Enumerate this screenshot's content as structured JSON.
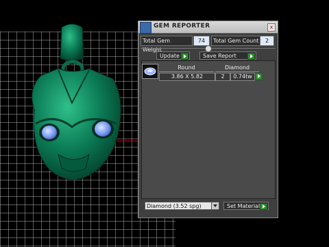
{
  "panel": {
    "title": "GEM REPORTER",
    "close_glyph": "x",
    "total_gem_weight_label": "Total Gem Weight",
    "total_gem_weight_value": "74",
    "total_gem_count_label": "Total Gem Count",
    "total_gem_count_value": "2",
    "update_label": "Update",
    "save_report_label": "Save Report",
    "table": {
      "headers": [
        "Round",
        "Diamond"
      ],
      "row": {
        "size": "3.86 X 5.82",
        "count": "2",
        "weight": "0.74tw"
      }
    },
    "material_select_value": "Diamond    (3.52 spg)",
    "set_material_label": "Set Material"
  },
  "colors": {
    "model_green": "#0b7a55",
    "gem_blue": "#7b9cf2",
    "panel_bg": "#3f3f3f",
    "button_green": "#2f8a2f"
  },
  "icons": {
    "title_icon": "gem-reporter-app-icon",
    "close": "close-icon",
    "arrow": "play-arrow-icon",
    "thumb": "round-gem-icon"
  }
}
